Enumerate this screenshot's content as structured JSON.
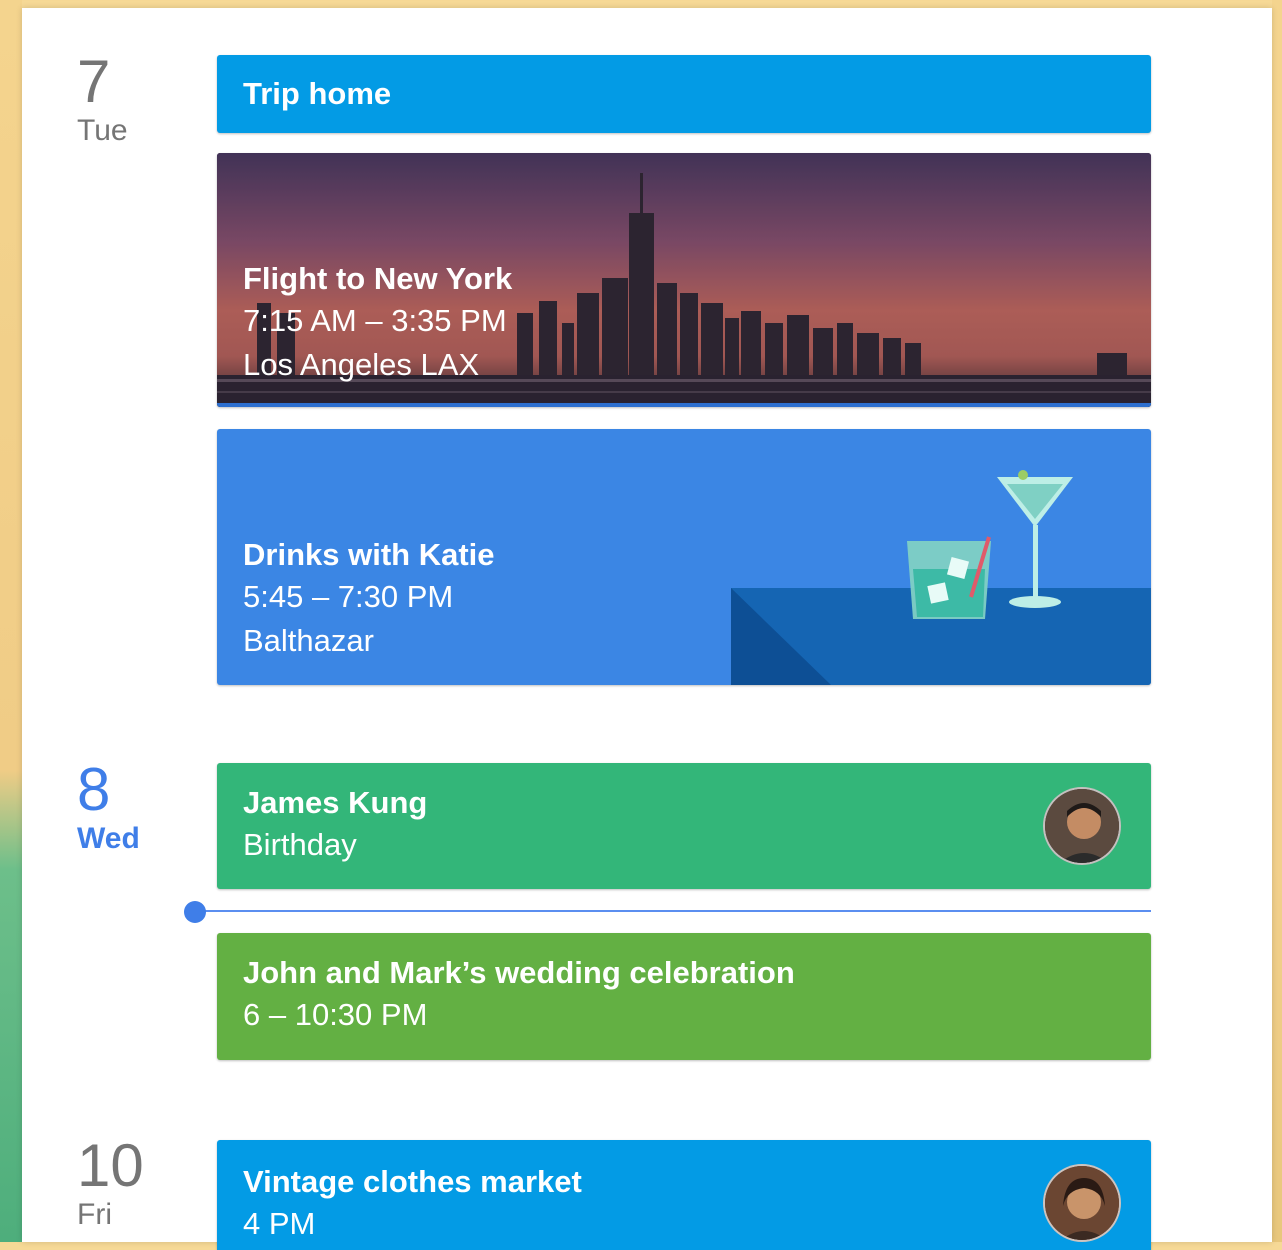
{
  "days": [
    {
      "number": "7",
      "weekday": "Tue"
    },
    {
      "number": "8",
      "weekday": "Wed"
    },
    {
      "number": "10",
      "weekday": "Fri"
    }
  ],
  "events": {
    "trip": {
      "title": "Trip home",
      "color": "#039be5"
    },
    "flight": {
      "title": "Flight to New York",
      "time": "7:15 AM – 3:35 PM",
      "location": "Los Angeles LAX"
    },
    "drinks": {
      "title": "Drinks with Katie",
      "time": "5:45 – 7:30 PM",
      "location": "Balthazar",
      "color": "#3b86e4"
    },
    "birthday": {
      "title": "James Kung",
      "subtitle": "Birthday",
      "color": "#33b679"
    },
    "wedding": {
      "title": "John and Mark’s wedding celebration",
      "time": "6 – 10:30 PM",
      "color": "#63b043"
    },
    "market": {
      "title": "Vintage clothes market",
      "time": "4 PM",
      "color": "#039be5"
    }
  },
  "icons": [
    "city-skyline-image",
    "cocktail-illustration",
    "avatar-james",
    "avatar-market",
    "current-time-indicator"
  ]
}
